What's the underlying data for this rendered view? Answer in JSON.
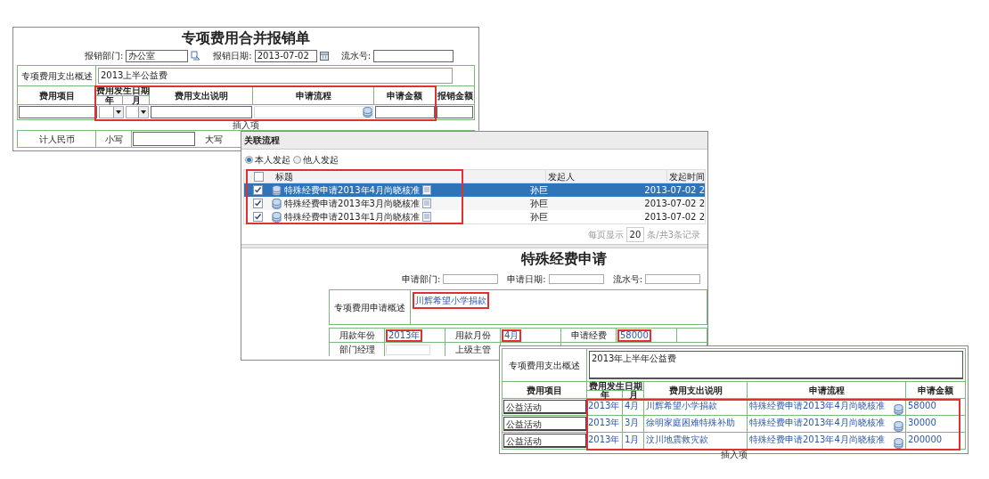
{
  "expense_form": {
    "title": "专项费用合并报销单",
    "fields": [
      {
        "label": "报销部门:",
        "value": "办公室",
        "kind": "lookup"
      },
      {
        "label": "报销日期:",
        "value": "2013-07-02",
        "kind": "date"
      },
      {
        "label": "流水号:",
        "kind": "text"
      }
    ],
    "summary": {
      "label": "专项费用支出概述",
      "value": "2013上半公益费"
    },
    "columns": [
      "费用项目",
      "费用发生日期",
      "费用支出说明",
      "申请流程",
      "申请金额",
      "报销金额"
    ],
    "date_subcolumns": [
      "年",
      "月"
    ],
    "insert_link": "插入项",
    "total_row": {
      "label": "计人民币",
      "small_label": "小写",
      "big_label": "大写"
    }
  },
  "related_process_dialog": {
    "title": "关联流程",
    "options": [
      {
        "label": "本人发起",
        "selected": true
      },
      {
        "label": "他人发起",
        "selected": false
      }
    ],
    "header_checked": false,
    "columns": [
      "标题",
      "发起人",
      "发起时间"
    ],
    "rows": [
      {
        "checked": true,
        "selected": true,
        "title": "特殊经费申请2013年4月尚晓核准",
        "initiator": "孙巨",
        "time": "2013-07-02 2"
      },
      {
        "checked": true,
        "selected": false,
        "title": "特殊经费申请2013年3月尚晓核准",
        "initiator": "孙巨",
        "time": "2013-07-02 2"
      },
      {
        "checked": true,
        "selected": false,
        "title": "特殊经费申请2013年1月尚晓核准",
        "initiator": "孙巨",
        "time": "2013-07-02 2"
      }
    ],
    "pager": {
      "prefix": "每页显示",
      "page_size": "20",
      "suffix": "条/共3条记录"
    }
  },
  "special_fund_form": {
    "title": "特殊经费申请",
    "fields": [
      "申请部门:",
      "申请日期:",
      "流水号:"
    ],
    "summary": {
      "label": "专项费用申请概述",
      "value": "川辉希望小学捐款"
    },
    "rows": [
      [
        {
          "label": "用款年份",
          "value": "2013年"
        },
        {
          "label": "用款月份",
          "value": "4月"
        },
        {
          "label": "申请经费",
          "value": "58000"
        }
      ],
      [
        {
          "label": "部门经理"
        },
        {
          "label": "上级主管"
        }
      ]
    ]
  },
  "merged_form": {
    "summary": {
      "label": "专项费用支出概述",
      "value": "2013年上半年公益费"
    },
    "columns": [
      "费用项目",
      "费用发生日期",
      "费用支出说明",
      "申请流程",
      "申请金额"
    ],
    "date_subcolumns": [
      "年",
      "月"
    ],
    "rows": [
      {
        "item": "公益活动",
        "year": "2013年",
        "month": "4月",
        "description": "川辉希望小学捐款",
        "process": "特殊经费申请2013年4月尚晓核准",
        "amount": "58000"
      },
      {
        "item": "公益活动",
        "year": "2013年",
        "month": "3月",
        "description": "徐明家庭困难特殊补助",
        "process": "特殊经费申请2013年4月尚晓核准",
        "amount": "30000"
      },
      {
        "item": "公益活动",
        "year": "2013年",
        "month": "1月",
        "description": "汶川地震救灾款",
        "process": "特殊经费申请2013年4月尚晓核准",
        "amount": "200000"
      }
    ],
    "insert_link": "插入项"
  }
}
